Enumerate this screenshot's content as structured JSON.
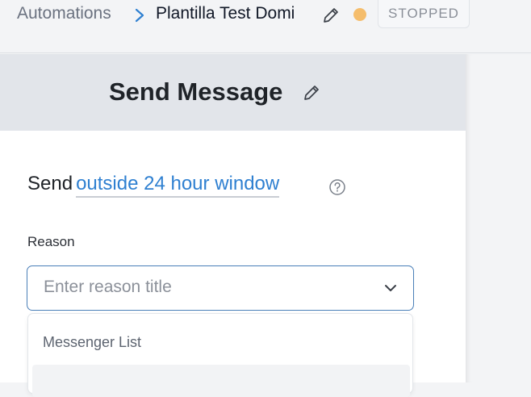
{
  "breadcrumb": {
    "root": "Automations",
    "current": "Plantilla Test Domi"
  },
  "status": {
    "label": "STOPPED",
    "dot_color": "#f5bd6c"
  },
  "panel": {
    "title": "Send Message",
    "send_prefix": "Send",
    "send_link": "outside 24 hour window",
    "reason_label": "Reason",
    "reason_placeholder": "Enter reason title",
    "dropdown_heading": "Messenger List"
  },
  "colors": {
    "link": "#2f80d1",
    "select_border": "#4a7fb8"
  },
  "icons": [
    "chevron-right-icon",
    "pencil-icon",
    "help-circle-icon",
    "chevron-down-icon"
  ]
}
